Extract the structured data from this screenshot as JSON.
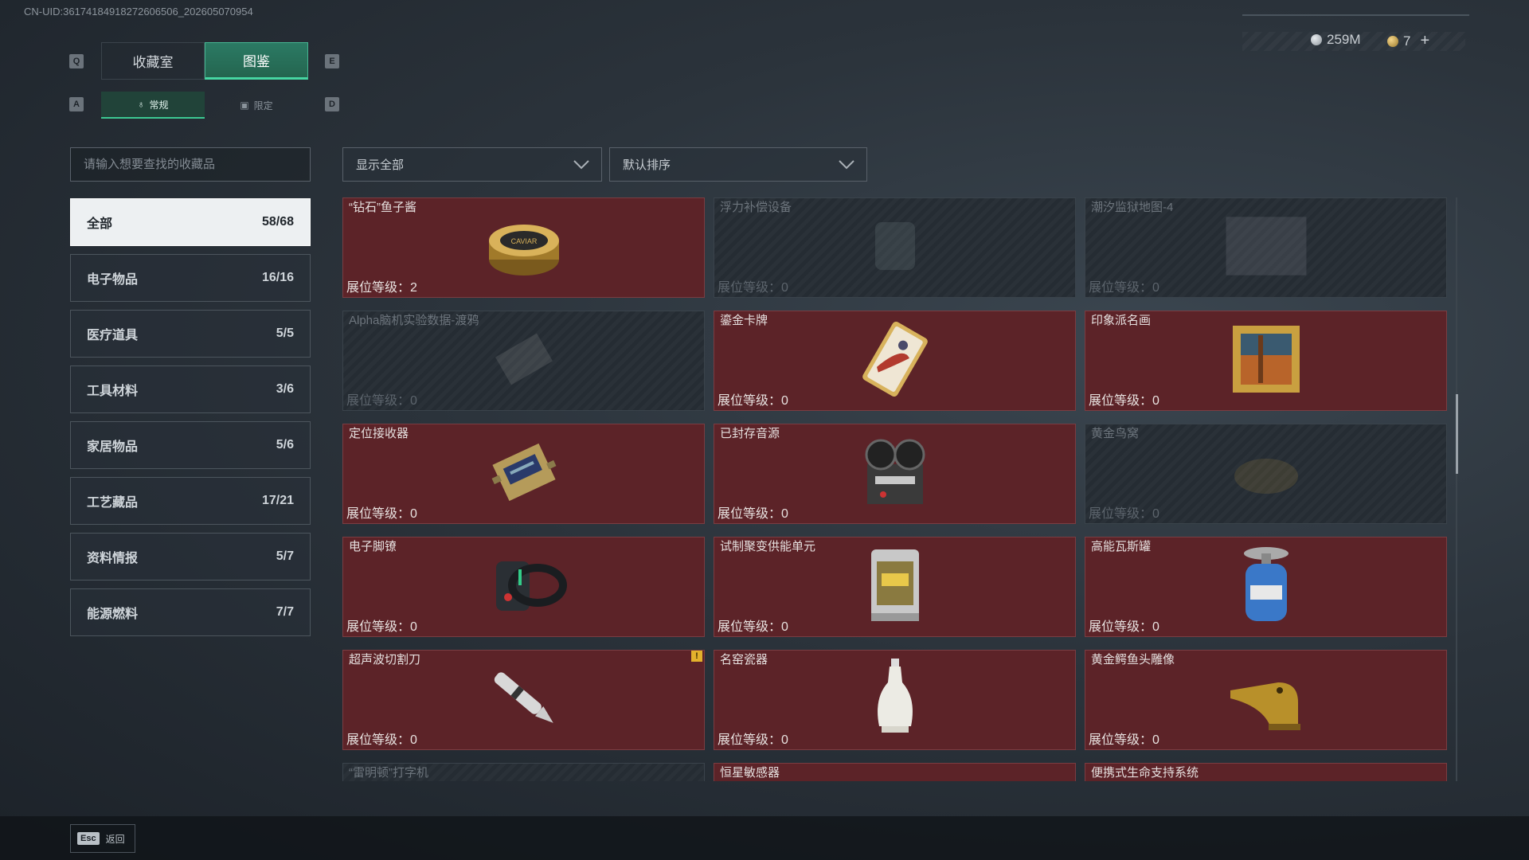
{
  "uid": "CN-UID:361741849182726065​06_202605070954",
  "currency": {
    "silver": "259M",
    "gold": "7",
    "plus": "+"
  },
  "keys": {
    "prev_tab": "Q",
    "next_tab": "E",
    "prev_sub": "A",
    "next_sub": "D"
  },
  "tabs": [
    {
      "label": "收藏室"
    },
    {
      "label": "图鉴"
    }
  ],
  "subtabs": [
    {
      "label": "常规",
      "icon": "♁"
    },
    {
      "label": "限定",
      "icon": "▣"
    }
  ],
  "search": {
    "placeholder": "请输入想要查找的收藏品"
  },
  "categories": [
    {
      "label": "全部",
      "count": "58/68"
    },
    {
      "label": "电子物品",
      "count": "16/16"
    },
    {
      "label": "医疗道具",
      "count": "5/5"
    },
    {
      "label": "工具材料",
      "count": "3/6"
    },
    {
      "label": "家居物品",
      "count": "5/6"
    },
    {
      "label": "工艺藏品",
      "count": "17/21"
    },
    {
      "label": "资料情报",
      "count": "5/7"
    },
    {
      "label": "能源燃料",
      "count": "7/7"
    }
  ],
  "filter": {
    "label": "显示全部"
  },
  "sort": {
    "label": "默认排序"
  },
  "items": [
    {
      "name": "“钻石”鱼子酱",
      "level": "展位等级：2",
      "owned": true,
      "icon": "caviar-tin-icon"
    },
    {
      "name": "浮力补偿设备",
      "level": "展位等级：0",
      "owned": false,
      "icon": "buoyancy-device-icon"
    },
    {
      "name": "潮汐监狱地图-4",
      "level": "展位等级：0",
      "owned": false,
      "icon": "map-icon"
    },
    {
      "name": "Alpha脑机实验数据-渡鸦",
      "level": "展位等级：0",
      "owned": false,
      "icon": "data-drive-icon"
    },
    {
      "name": "鎏金卡牌",
      "level": "展位等级：0",
      "owned": true,
      "icon": "gilded-card-icon"
    },
    {
      "name": "印象派名画",
      "level": "展位等级：0",
      "owned": true,
      "icon": "painting-icon"
    },
    {
      "name": "定位接收器",
      "level": "展位等级：0",
      "owned": true,
      "icon": "receiver-icon"
    },
    {
      "name": "已封存音源",
      "level": "展位等级：0",
      "owned": true,
      "icon": "tape-recorder-icon"
    },
    {
      "name": "黄金鸟窝",
      "level": "展位等级：0",
      "owned": false,
      "icon": "golden-nest-icon"
    },
    {
      "name": "电子脚镣",
      "level": "展位等级：0",
      "owned": true,
      "icon": "ankle-monitor-icon"
    },
    {
      "name": "试制聚变供能单元",
      "level": "展位等级：0",
      "owned": true,
      "icon": "fusion-cell-icon"
    },
    {
      "name": "高能瓦斯罐",
      "level": "展位等级：0",
      "owned": true,
      "icon": "gas-canister-icon"
    },
    {
      "name": "超声波切割刀",
      "level": "展位等级：0",
      "owned": true,
      "icon": "ultrasonic-cutter-icon",
      "warning": "!"
    },
    {
      "name": "名窑瓷器",
      "level": "展位等级：0",
      "owned": true,
      "icon": "porcelain-vase-icon"
    },
    {
      "name": "黄金鳄鱼头雕像",
      "level": "展位等级：0",
      "owned": true,
      "icon": "crocodile-head-icon"
    },
    {
      "name": "“雷明顿”打字机",
      "level": "",
      "owned": false,
      "icon": "typewriter-icon"
    },
    {
      "name": "恒星敏感器",
      "level": "",
      "owned": true,
      "icon": "star-sensor-icon"
    },
    {
      "name": "便携式生命支持系统",
      "level": "",
      "owned": true,
      "icon": "life-support-icon"
    }
  ],
  "footer": {
    "esc_key": "Esc",
    "esc_label": "返回"
  }
}
